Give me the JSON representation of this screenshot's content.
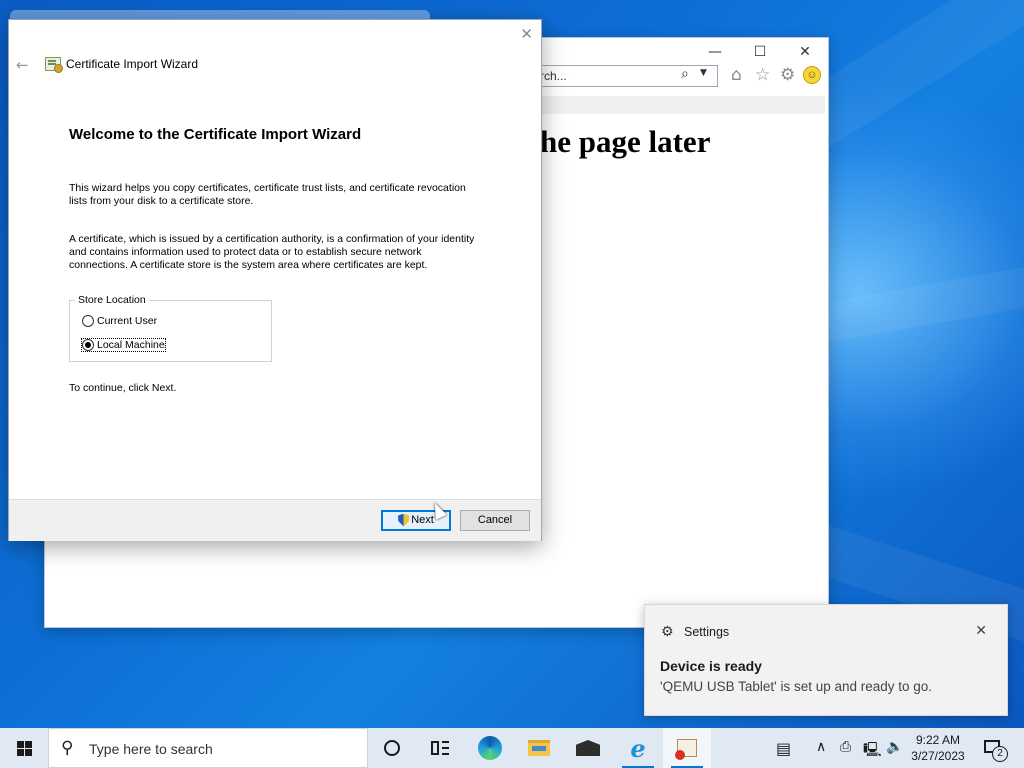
{
  "browser": {
    "search_placeholder": "rch...",
    "page_heading": "he page later",
    "icons": [
      "search-icon",
      "home-icon",
      "star-icon",
      "gear-icon",
      "smiley-icon"
    ]
  },
  "wizard": {
    "window_title": "Certificate Import Wizard",
    "heading": "Welcome to the Certificate Import Wizard",
    "para1_line1": "This wizard helps you copy certificates, certificate trust lists, and certificate revocation",
    "para1_line2": "lists from your disk to a certificate store.",
    "para2_line1": "A certificate, which is issued by a certification authority, is a confirmation of your identity",
    "para2_line2": "and contains information used to protect data or to establish secure network",
    "para2_line3": "connections. A certificate store is the system area where certificates are kept.",
    "store_location": {
      "legend": "Store Location",
      "options": [
        {
          "label": "Current User",
          "selected": false
        },
        {
          "label": "Local Machine",
          "selected": true
        }
      ]
    },
    "continue_text": "To continue, click Next.",
    "next_label": "Next",
    "cancel_label": "Cancel"
  },
  "toast": {
    "app_name": "Settings",
    "title": "Device is ready",
    "body": "'QEMU USB Tablet' is set up and ready to go."
  },
  "taskbar": {
    "search_placeholder": "Type here to search",
    "time": "9:22 AM",
    "date": "3/27/2023",
    "notification_count": "2",
    "accent": "#0078d7"
  }
}
